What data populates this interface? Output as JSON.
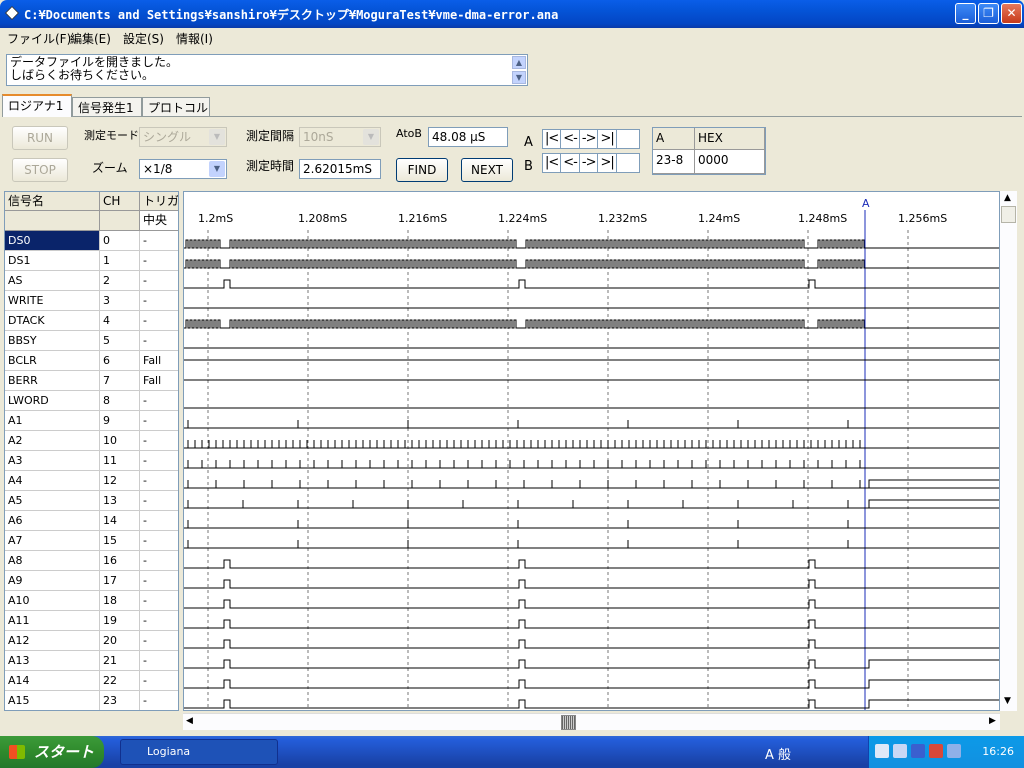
{
  "window": {
    "title": "C:¥Documents and Settings¥sanshiro¥デスクトップ¥MoguraTest¥vme-dma-error.ana"
  },
  "menu": [
    "ファイル(F)",
    "編集(E)",
    "設定(S)",
    "情報(I)"
  ],
  "status": {
    "line1": "データファイルを開きました。",
    "line2": "しばらくお待ちください。"
  },
  "tabs": [
    "ロジアナ1",
    "信号発生1",
    "プロトコル"
  ],
  "controls": {
    "run": "RUN",
    "stop": "STOP",
    "mode_label": "測定モード",
    "mode_value": "シングル",
    "zoom_label": "ズーム",
    "zoom_value": "×1/8",
    "interval_label": "測定間隔",
    "interval_value": "10nS",
    "time_label": "測定時間",
    "time_value": "2.62015mS",
    "atob_label": "AtoB",
    "atob_value": "48.08 μS",
    "find": "FIND",
    "next": "NEXT",
    "a_label": "A",
    "b_label": "B",
    "nav": [
      "|<",
      "<-",
      "->",
      ">|"
    ]
  },
  "hex_grid": {
    "col1": "A",
    "col2": "HEX",
    "val1": "23-8",
    "val2": "0000"
  },
  "signal_table": {
    "headers": {
      "name": "信号名",
      "ch": "CH",
      "trig": "トリガ",
      "trig_sub": "中央"
    },
    "rows": [
      {
        "name": "DS0",
        "ch": "0",
        "trig": "-"
      },
      {
        "name": "DS1",
        "ch": "1",
        "trig": "-"
      },
      {
        "name": "AS",
        "ch": "2",
        "trig": "-"
      },
      {
        "name": "WRITE",
        "ch": "3",
        "trig": "-"
      },
      {
        "name": "DTACK",
        "ch": "4",
        "trig": "-"
      },
      {
        "name": "BBSY",
        "ch": "5",
        "trig": "-"
      },
      {
        "name": "BCLR",
        "ch": "6",
        "trig": "Fall"
      },
      {
        "name": "BERR",
        "ch": "7",
        "trig": "Fall"
      },
      {
        "name": "LWORD",
        "ch": "8",
        "trig": "-"
      },
      {
        "name": "A1",
        "ch": "9",
        "trig": "-"
      },
      {
        "name": "A2",
        "ch": "10",
        "trig": "-"
      },
      {
        "name": "A3",
        "ch": "11",
        "trig": "-"
      },
      {
        "name": "A4",
        "ch": "12",
        "trig": "-"
      },
      {
        "name": "A5",
        "ch": "13",
        "trig": "-"
      },
      {
        "name": "A6",
        "ch": "14",
        "trig": "-"
      },
      {
        "name": "A7",
        "ch": "15",
        "trig": "-"
      },
      {
        "name": "A8",
        "ch": "16",
        "trig": "-"
      },
      {
        "name": "A9",
        "ch": "17",
        "trig": "-"
      },
      {
        "name": "A10",
        "ch": "18",
        "trig": "-"
      },
      {
        "name": "A11",
        "ch": "19",
        "trig": "-"
      },
      {
        "name": "A12",
        "ch": "20",
        "trig": "-"
      },
      {
        "name": "A13",
        "ch": "21",
        "trig": "-"
      },
      {
        "name": "A14",
        "ch": "22",
        "trig": "-"
      },
      {
        "name": "A15",
        "ch": "23",
        "trig": "-"
      }
    ]
  },
  "timeline": {
    "ticks": [
      "1.2mS",
      "1.208mS",
      "1.216mS",
      "1.224mS",
      "1.232mS",
      "1.24mS",
      "1.248mS",
      "1.256mS"
    ],
    "cursor_label": "A"
  },
  "taskbar": {
    "start": "スタート",
    "task": "Logiana",
    "clock": "16:26",
    "ime": "A 般"
  },
  "colors": {
    "selection": "#0a246a",
    "cursor": "#1a2bb8",
    "titlebar": "#0453d6"
  }
}
